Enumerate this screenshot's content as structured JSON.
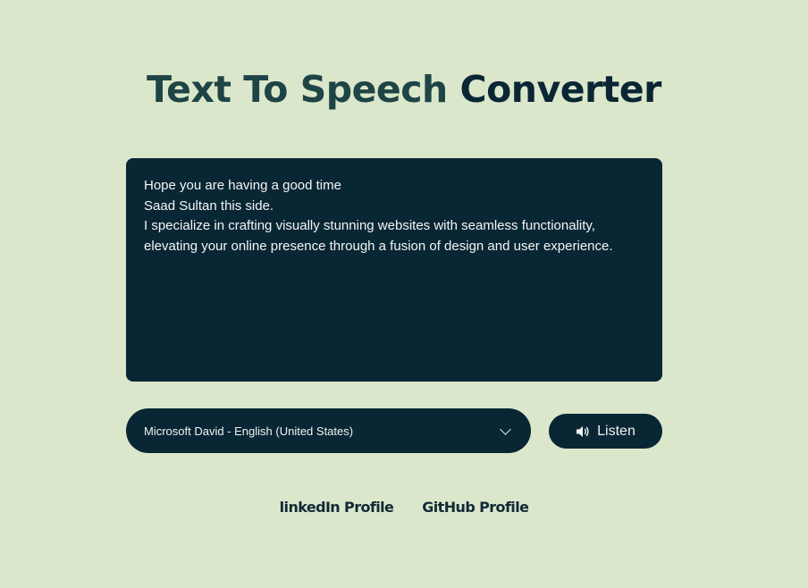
{
  "title": {
    "part1": "Text To Speech",
    "part2": "Converter"
  },
  "textarea": {
    "lines": [
      "Hope you are having a good time",
      "Saad Sultan this side.",
      "I specialize in crafting visually stunning websites with seamless functionality,",
      "elevating your online presence through a fusion of design and user experience."
    ]
  },
  "voice_select": {
    "selected": "Microsoft David - English (United States)",
    "icon": "chevron-down-icon"
  },
  "listen_button": {
    "label": "Listen",
    "icon": "speaker-icon"
  },
  "links": {
    "linkedin": "linkedIn Profile",
    "github": "GitHub Profile"
  },
  "colors": {
    "background": "#dbe7cb",
    "panel": "#092635",
    "title_accent": "#1e4445",
    "title_dark": "#0a2534"
  }
}
